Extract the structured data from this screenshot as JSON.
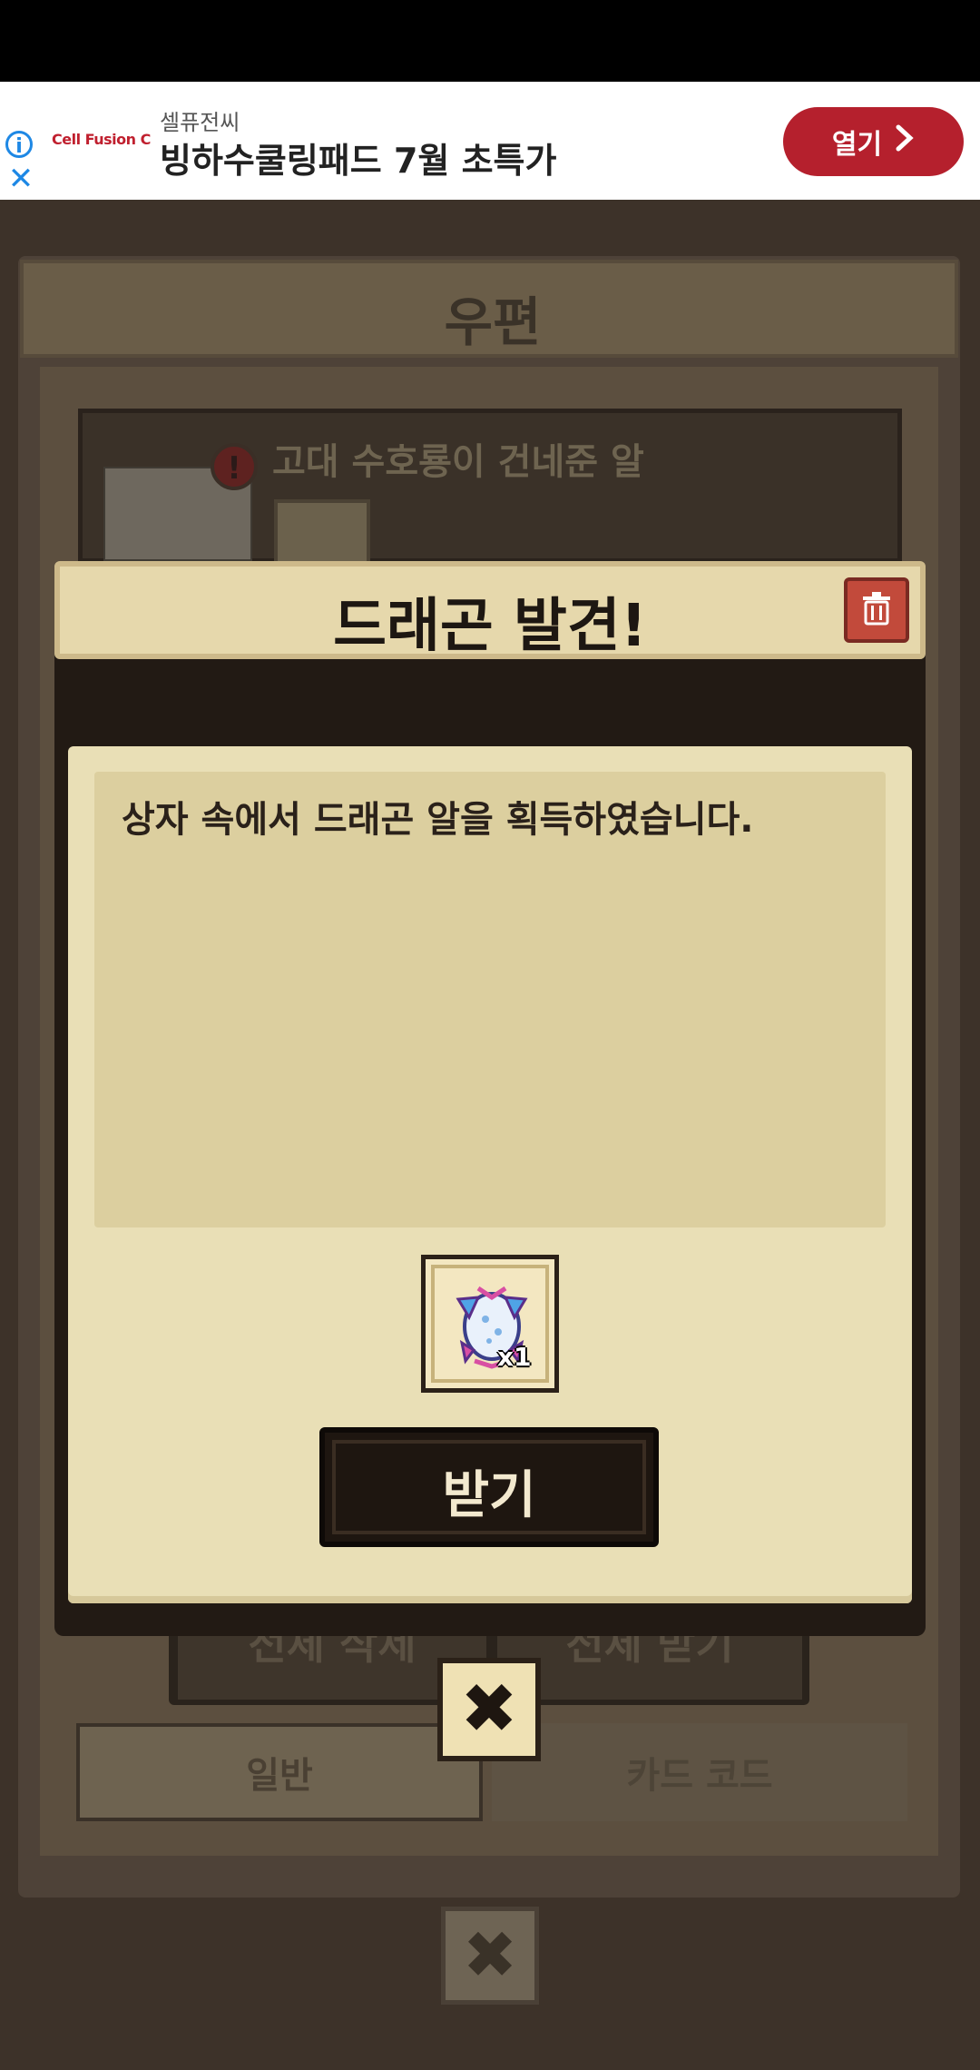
{
  "ad": {
    "info_icon": "info-icon",
    "close_icon": "close-icon",
    "logo_text": "Cell Fusion C",
    "brand": "셀퓨전씨",
    "headline": "빙하수쿨링패드 7월 초특가",
    "open_label": "열기",
    "open_arrow": "chevron-right-icon"
  },
  "background_window": {
    "title": "우편",
    "mail_item_title": "고대 수호룡이 건네준 알",
    "buttons": [
      "전체 삭제",
      "전체 받기"
    ],
    "tabs": [
      "일반",
      "카드 코드"
    ],
    "close_symbol": "✖"
  },
  "dialog": {
    "title": "드래곤 발견!",
    "delete_icon": "trash-icon",
    "message": "상자 속에서 드래곤 알을 획득하였습니다.",
    "reward": {
      "item_icon": "dragon-egg-icon",
      "quantity": "x1"
    },
    "receive_label": "받기",
    "close_symbol": "✖"
  },
  "colors": {
    "ad_button": "#b5202d",
    "dialog_header": "#e6d8ac",
    "dialog_content": "#e9dfb6",
    "trash_button": "#c24a3b"
  }
}
